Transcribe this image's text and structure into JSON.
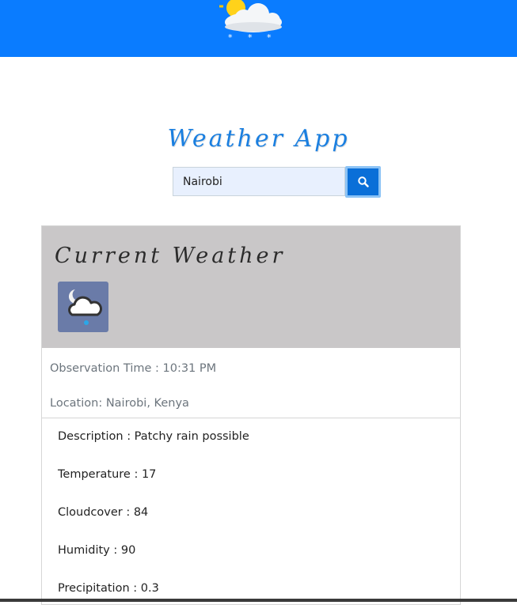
{
  "banner": {
    "icon": "sun-cloud-snow-icon",
    "color": "#0a7cff"
  },
  "app": {
    "title": "Weather App"
  },
  "search": {
    "value": "Nairobi",
    "button_icon": "search-icon"
  },
  "card": {
    "title": "Current Weather",
    "weather_icon": "night-cloud-rain-icon",
    "observation_time": "Observation Time : 10:31 PM",
    "location": "Location: Nairobi, Kenya",
    "details": [
      "Description : Patchy rain possible",
      "Temperature : 17",
      "Cloudcover : 84",
      "Humidity : 90",
      "Precipitation : 0.3"
    ]
  }
}
